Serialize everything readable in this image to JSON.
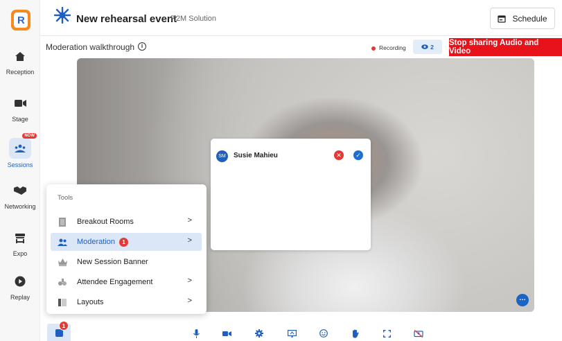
{
  "header": {
    "event_title": "New rehearsal event",
    "org_name": "R2M Solution",
    "schedule_label": "Schedule"
  },
  "sidebar": {
    "logo_letter": "R",
    "items": [
      {
        "label": "Reception",
        "icon": "home-icon"
      },
      {
        "label": "Stage",
        "icon": "video-camera-icon"
      },
      {
        "label": "Sessions",
        "icon": "sessions-group-icon",
        "badge": "NOW"
      },
      {
        "label": "Networking",
        "icon": "handshake-icon"
      },
      {
        "label": "Expo",
        "icon": "booth-icon"
      },
      {
        "label": "Replay",
        "icon": "play-circle-icon"
      }
    ]
  },
  "subheader": {
    "session_title": "Moderation walkthrough",
    "recording_label": "Recording",
    "viewer_count": "2",
    "stop_label": "Stop sharing Audio and Video"
  },
  "moderation_panel": {
    "avatar_initials": "SM",
    "name": "Susie Mahieu",
    "reject_symbol": "✕",
    "accept_symbol": "✓"
  },
  "tools_menu": {
    "title": "Tools",
    "items": [
      {
        "label": "Breakout Rooms",
        "icon": "door-icon",
        "has_submenu": true
      },
      {
        "label": "Moderation",
        "icon": "users-icon",
        "badge": "1",
        "has_submenu": true,
        "active": true
      },
      {
        "label": "New Session Banner",
        "icon": "crown-icon",
        "has_submenu": false
      },
      {
        "label": "Attendee Engagement",
        "icon": "engagement-icon",
        "has_submenu": true
      },
      {
        "label": "Layouts",
        "icon": "layout-icon",
        "has_submenu": true
      }
    ],
    "chevron": ">"
  },
  "bottom_bar": {
    "tools_badge": "1",
    "controls": [
      "microphone-icon",
      "camera-icon",
      "settings-icon",
      "screen-share-icon",
      "emoji-icon",
      "raise-hand-icon",
      "fullscreen-icon",
      "hide-self-icon"
    ]
  },
  "video": {
    "more_symbol": "…"
  },
  "colors": {
    "primary": "#1f5fbf",
    "danger": "#e8121b",
    "active_bg": "#dbe7f6",
    "logo_orange": "#f48a20"
  }
}
